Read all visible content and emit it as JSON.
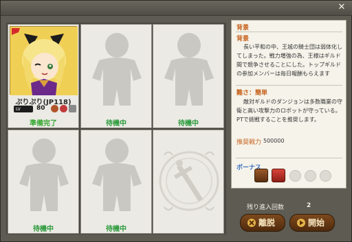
{
  "window": {
    "close_glyph": "✕"
  },
  "party": {
    "slots": [
      {
        "name": "ぷりぷり(JP118)",
        "level_label": "LV",
        "level": "80",
        "status": "準備完了"
      },
      {
        "status": "待機中"
      },
      {
        "status": "待機中"
      },
      {
        "status": "待機中"
      },
      {
        "status": "待機中"
      }
    ]
  },
  "info": {
    "section_title": "背景",
    "background_heading": "背景",
    "background_text": "長い平和の中、王城の騎士団は弱体化してしまった。戦力増強の為、王様はギルド間で競争させることにした。トップギルドの参加メンバーは毎日報酬もらえます",
    "difficulty_heading": "難さ：簡単",
    "difficulty_text": "敵対ギルドのダンジョンは多数職業の守衛と高い攻撃力のロボットが守っている。PTで挑戦することを推奨します。",
    "recommended_label": "推奨戦力",
    "recommended_value": "500000",
    "bonus_label": "ボーナス"
  },
  "footer": {
    "remaining_label": "残り進入回数",
    "remaining_value": "2",
    "leave_label": "離脱",
    "start_label": "開始"
  },
  "colors": {
    "ready": "#37a832",
    "waiting": "#2a9a3a",
    "heading_orange": "#c86420",
    "bonus_blue": "#3a6fc0"
  }
}
